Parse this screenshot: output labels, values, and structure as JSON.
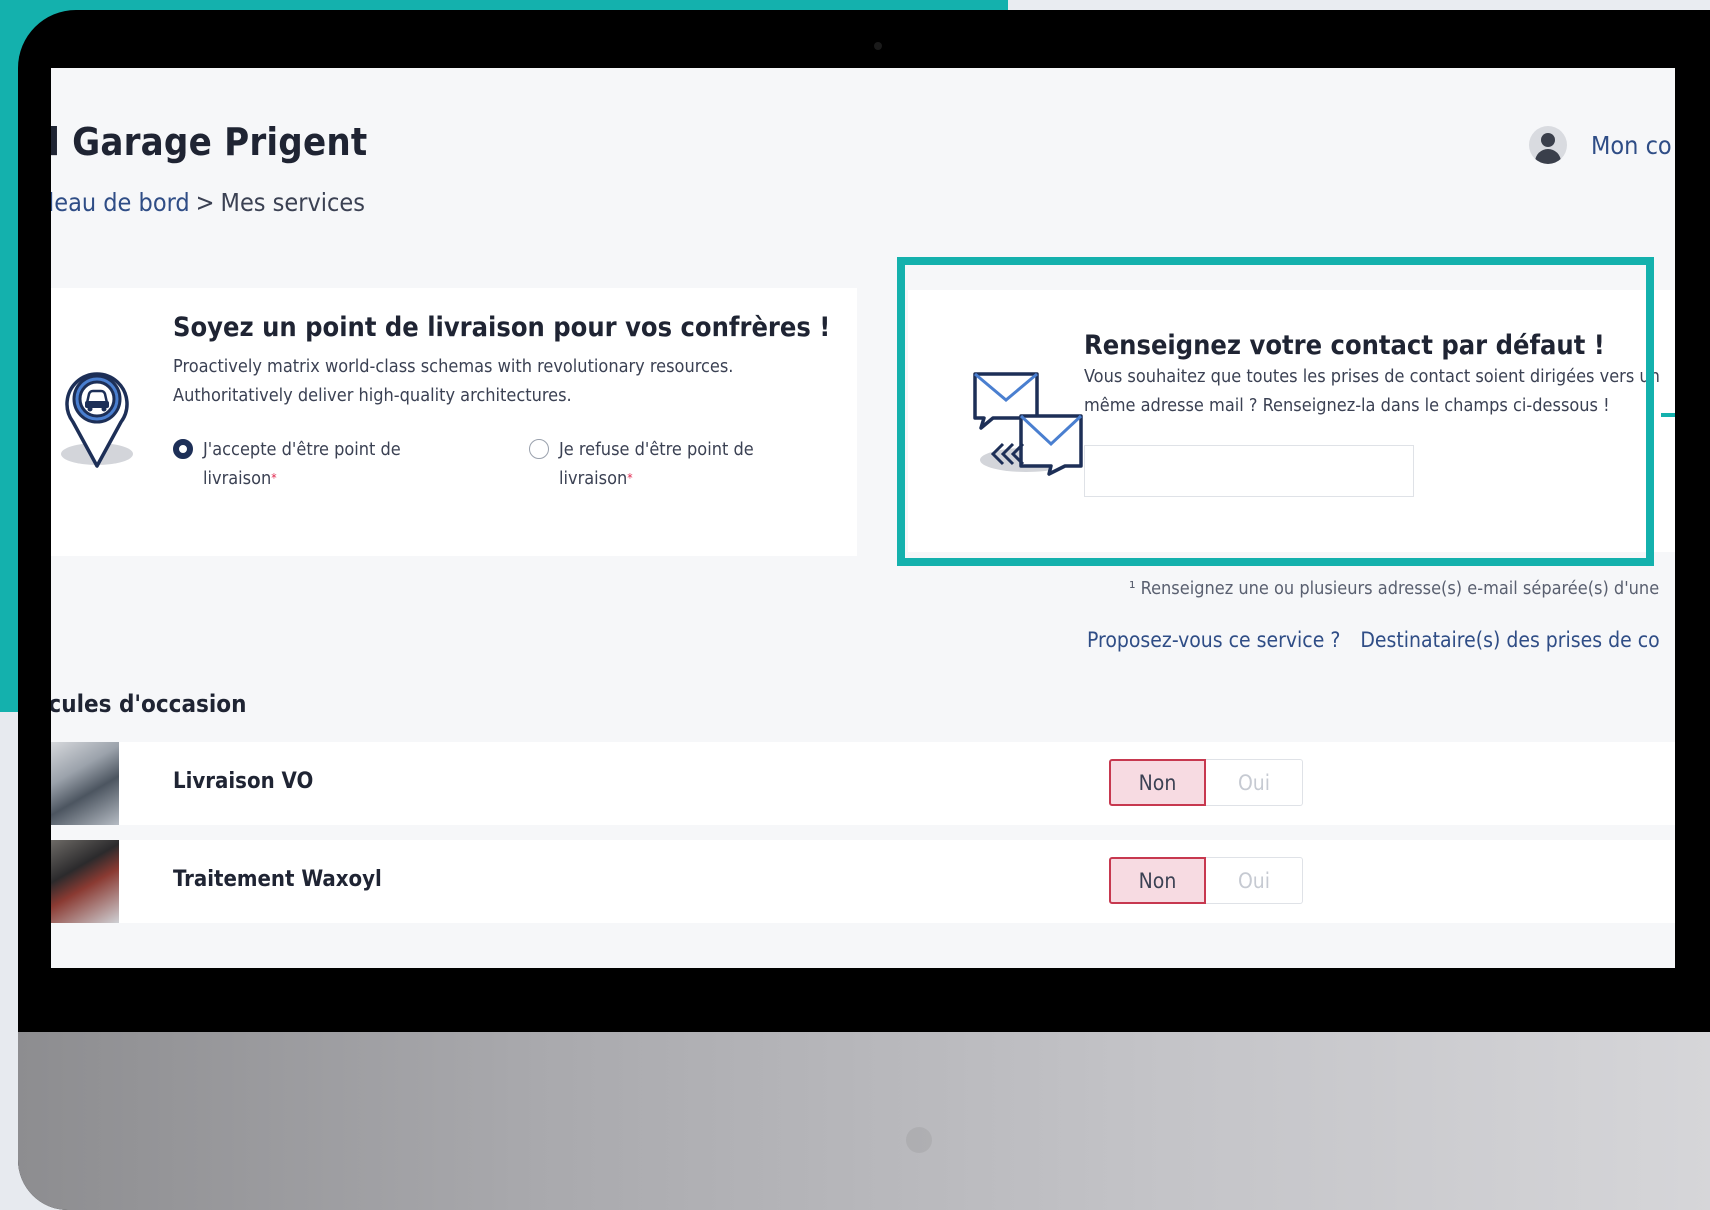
{
  "page": {
    "title": "rl Garage Prigent",
    "breadcrumb": {
      "parent": "leau de bord",
      "separator": ">",
      "current": "Mes services"
    },
    "account_label": "Mon co"
  },
  "delivery_card": {
    "title": "Soyez un point de livraison pour vos confrères !",
    "text_line1": "Proactively matrix world-class schemas with revolutionary resources.",
    "text_line2": "Authoritatively deliver high-quality architectures.",
    "accept": {
      "line1": "J'accepte d'être point de",
      "line2": "livraison",
      "selected": true
    },
    "refuse": {
      "line1": "Je refuse d'être point de",
      "line2": "livraison",
      "selected": false
    },
    "required_mark": "*"
  },
  "contact_card": {
    "title": "Renseignez votre contact par défaut !",
    "text_line1": "Vous souhaitez que toutes les prises de contact soient dirigées vers un",
    "text_line2": "même adresse mail ? Renseignez-la dans le champs ci-dessous !",
    "email_value": "",
    "highlight_color": "#14b1ad"
  },
  "footnote": "¹ Renseignez une ou plusieurs adresse(s) e-mail séparée(s) d'une",
  "header_links": {
    "service": "Proposez-vous ce service ?",
    "recipients": "Destinataire(s) des prises de co"
  },
  "section": {
    "title": "icules d'occasion"
  },
  "services": [
    {
      "name": "Livraison VO",
      "non": "Non",
      "oui": "Oui",
      "selected": "Non"
    },
    {
      "name": "Traitement Waxoyl",
      "non": "Non",
      "oui": "Oui",
      "selected": "Non"
    }
  ],
  "colors": {
    "teal": "#14b1ad",
    "navy": "#1d2f57",
    "link": "#2f4d86",
    "toggle_selected_bg": "#f7dbe2",
    "toggle_selected_border": "#c7384f"
  },
  "icons": {
    "avatar": "user-avatar-icon",
    "delivery": "map-pin-car-icon",
    "mail": "mail-exchange-icon"
  }
}
